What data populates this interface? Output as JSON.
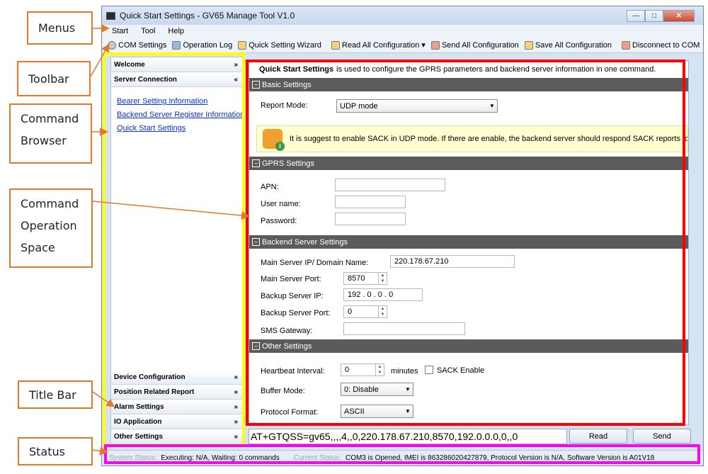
{
  "window": {
    "title": "Quick Start Settings - GV65 Manage Tool V1.0"
  },
  "menus": [
    "Start",
    "Tool",
    "Help"
  ],
  "toolbar": {
    "com_settings": "COM Settings",
    "operation_log": "Operation Log",
    "quick_setting_wizard": "Quick Setting Wizard",
    "read_all": "Read All Configuration",
    "send_all": "Send All Configuration",
    "save_all": "Save All Configuration",
    "disconnect": "Disconnect to COM"
  },
  "sidebar": {
    "welcome": "Welcome",
    "server_connection": "Server Connection",
    "links": [
      "Bearer Setting Information",
      "Backend Server Register Information",
      "Quick Start Settings"
    ],
    "bottom_sections": [
      "Device Configuration",
      "Position Related Report",
      "Alarm Settings",
      "IO Application",
      "Other Settings"
    ]
  },
  "main": {
    "intro_bold": "Quick Start Settings",
    "intro_text": "is used to configure the GPRS parameters and backend server information in one command.",
    "basic": {
      "header": "Basic Settings",
      "report_mode_label": "Report Mode:",
      "report_mode_value": "UDP mode",
      "notice": "It is suggest to enable SACK in UDP mode. If there are enable, the backend server should respond SACK reports to u"
    },
    "gprs": {
      "header": "GPRS Settings",
      "apn_label": "APN:",
      "apn_value": "",
      "username_label": "User name:",
      "username_value": "",
      "password_label": "Password:",
      "password_value": ""
    },
    "backend": {
      "header": "Backend Server Settings",
      "main_ip_label": "Main Server IP/ Domain Name:",
      "main_ip_value": "220.178.67.210",
      "main_port_label": "Main Server Port:",
      "main_port_value": "8570",
      "backup_ip_label": "Backup Server IP:",
      "backup_ip_value": "192 .  0  .  0  .  0",
      "backup_port_label": "Backup Server Port:",
      "backup_port_value": "0",
      "sms_label": "SMS Gateway:",
      "sms_value": ""
    },
    "other": {
      "header": "Other Settings",
      "heartbeat_label": "Heartbeat Interval:",
      "heartbeat_value": "0",
      "heartbeat_unit": "minutes",
      "sack_label": "SACK Enable",
      "buffer_label": "Buffer Mode:",
      "buffer_value": "0: Disable",
      "protocol_label": "Protocol Format:",
      "protocol_value": "ASCII"
    }
  },
  "command": {
    "text": "AT+GTQSS=gv65,,,,4,,0,220.178.67.210,8570,192.0.0.0,0,,0",
    "read": "Read",
    "send": "Send"
  },
  "status": {
    "system_label": "System Status:",
    "system_value": "Executing: N/A, Waiting: 0 commands",
    "current_label": "Current Status:",
    "current_value": "COM3 is Opened, IMEI is 863286020427879, Protocol Version is N/A, Software Version is A01V18"
  },
  "callouts": {
    "menus": "Menus",
    "toolbar": "Toolbar",
    "command_browser": [
      "Command",
      "Browser"
    ],
    "command_operation_space": [
      "Command",
      "Operation",
      "Space"
    ],
    "title_bar": "Title Bar",
    "status": "Status"
  },
  "colors": {
    "callout_border": "#e6782a",
    "highlight_sidebar": "#ffff00",
    "highlight_main": "#ff0000",
    "highlight_status": "#ff00ff",
    "section_header": "#5b5b5b"
  }
}
